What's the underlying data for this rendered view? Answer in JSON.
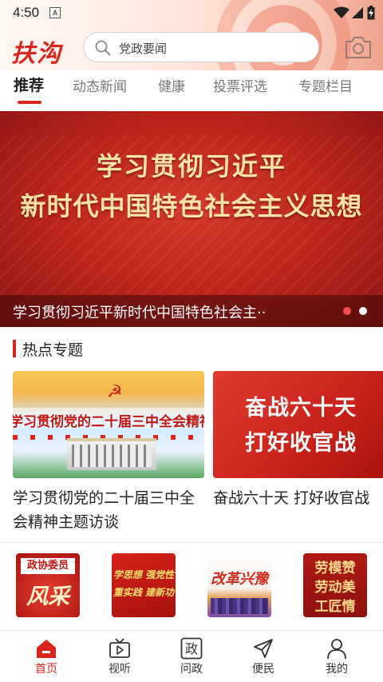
{
  "status_bar": {
    "time": "4:50",
    "sim_label": "A"
  },
  "header": {
    "logo": "扶沟",
    "search_placeholder": "党政要闻"
  },
  "tabs": [
    {
      "label": "推荐",
      "active": true
    },
    {
      "label": "动态新闻",
      "active": false
    },
    {
      "label": "健康",
      "active": false
    },
    {
      "label": "投票评选",
      "active": false
    },
    {
      "label": "专题栏目",
      "active": false
    }
  ],
  "banner": {
    "line1": "学习贯彻习近平",
    "line2": "新时代中国特色社会主义思想",
    "caption": "学习贯彻习近平新时代中国特色社会主··",
    "slide_count": 2,
    "active_slide": 1
  },
  "hot_topics": {
    "title": "热点专题",
    "cards": [
      {
        "image_text": "学习贯彻党的二十届三中全会精神",
        "caption": "学习贯彻党的二十届三中全会精神主题访谈"
      },
      {
        "image_line1": "奋战六十天",
        "image_line2": "打好收官战",
        "caption": "奋战六十天 打好收官战"
      }
    ]
  },
  "shortcuts": [
    {
      "top": "政协委员",
      "main": "风采录"
    },
    {
      "line1": "学思想 强党性",
      "line2": "重实践 建新功"
    },
    {
      "main": "改革兴豫"
    },
    {
      "line1": "劳模赞",
      "line2": "劳动美",
      "line3": "工匠情"
    }
  ],
  "bottom_nav": [
    {
      "label": "首页",
      "icon": "home-icon",
      "active": true
    },
    {
      "label": "视听",
      "icon": "tv-play-icon",
      "active": false
    },
    {
      "label": "问政",
      "icon": "zheng-icon",
      "glyph": "政",
      "active": false
    },
    {
      "label": "便民",
      "icon": "paper-plane-icon",
      "active": false
    },
    {
      "label": "我的",
      "icon": "user-icon",
      "active": false
    }
  ],
  "colors": {
    "accent": "#d9261c",
    "text": "#222222",
    "muted": "#777777"
  }
}
